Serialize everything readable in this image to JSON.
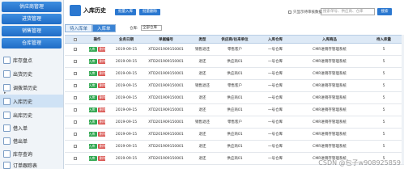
{
  "sidebar": {
    "sections": [
      "供应商管理",
      "进货管理",
      "销售管理",
      "仓库管理"
    ],
    "items": [
      {
        "label": "库存盘点",
        "active": false
      },
      {
        "label": "出货历史",
        "active": false
      },
      {
        "label": "调拨单历史",
        "active": false
      },
      {
        "label": "入库历史",
        "active": true
      },
      {
        "label": "出库历史",
        "active": false
      },
      {
        "label": "借入单",
        "active": false
      },
      {
        "label": "借出单",
        "active": false
      },
      {
        "label": "库存查询",
        "active": false
      },
      {
        "label": "订单跟踪表",
        "active": false
      }
    ],
    "expand_icon": "▸"
  },
  "header": {
    "title": "入库历史",
    "buttons": [
      "批量入库",
      "批量删除"
    ],
    "checkbox_label": "只显示待审核数据",
    "search_placeholder": "搜索单号、供应商、仓库",
    "search_button": "搜索"
  },
  "tabs": [
    "待入库单",
    "入库单"
  ],
  "store_filter": {
    "label": "仓库:",
    "value": "全部仓库"
  },
  "table": {
    "headers": [
      "",
      "操作",
      "业务日期",
      "单据编号",
      "类型",
      "供应商/往来单位",
      "入库仓库",
      "入库商品",
      "待入库量"
    ],
    "rows": [
      {
        "date": "2019-09-15",
        "no": "XTD201909150001",
        "type": "销售退还",
        "partner": "零售客户",
        "warehouse": "一号仓库",
        "goods": "CMR进销存管理系统",
        "qty": "5"
      },
      {
        "date": "2019-09-15",
        "no": "XTD201909150001",
        "type": "退还",
        "partner": "供应商01",
        "warehouse": "一号仓库",
        "goods": "CMR进销存管理系统",
        "qty": "5"
      },
      {
        "date": "2019-09-15",
        "no": "XTD201909150001",
        "type": "退还",
        "partner": "供应商01",
        "warehouse": "一号仓库",
        "goods": "CMR进销存管理系统",
        "qty": "5"
      },
      {
        "date": "2019-09-15",
        "no": "XTD201909150001",
        "type": "销售退还",
        "partner": "零售客户",
        "warehouse": "一号仓库",
        "goods": "CMR进销存管理系统",
        "qty": "5"
      },
      {
        "date": "2019-09-15",
        "no": "XTD201909150001",
        "type": "退还",
        "partner": "供应商01",
        "warehouse": "一号仓库",
        "goods": "CMR进销存管理系统",
        "qty": "5"
      },
      {
        "date": "2019-09-15",
        "no": "XTD201909150001",
        "type": "退还",
        "partner": "供应商01",
        "warehouse": "一号仓库",
        "goods": "CMR进销存管理系统",
        "qty": "5"
      },
      {
        "date": "2019-09-15",
        "no": "XTD201909150001",
        "type": "销售退还",
        "partner": "零售客户",
        "warehouse": "一号仓库",
        "goods": "CMR进销存管理系统",
        "qty": "5"
      },
      {
        "date": "2019-09-15",
        "no": "XTD201909150001",
        "type": "退还",
        "partner": "供应商01",
        "warehouse": "一号仓库",
        "goods": "CMR进销存管理系统",
        "qty": "5"
      },
      {
        "date": "2019-09-15",
        "no": "XTD201909150001",
        "type": "退还",
        "partner": "供应商01",
        "warehouse": "一号仓库",
        "goods": "CMR进销存管理系统",
        "qty": "5"
      },
      {
        "date": "2019-09-15",
        "no": "XTD201909150001",
        "type": "退还",
        "partner": "供应商01",
        "warehouse": "一号仓库",
        "goods": "CMR进销存管理系统",
        "qty": "5"
      }
    ],
    "op_labels": [
      "入库",
      "删除"
    ]
  },
  "watermark": "CSDN @包子w908925859",
  "colors": {
    "accent": "#2b78d0",
    "header_bg": "#dde9f6",
    "green": "#33a852",
    "red": "#d9534f"
  }
}
